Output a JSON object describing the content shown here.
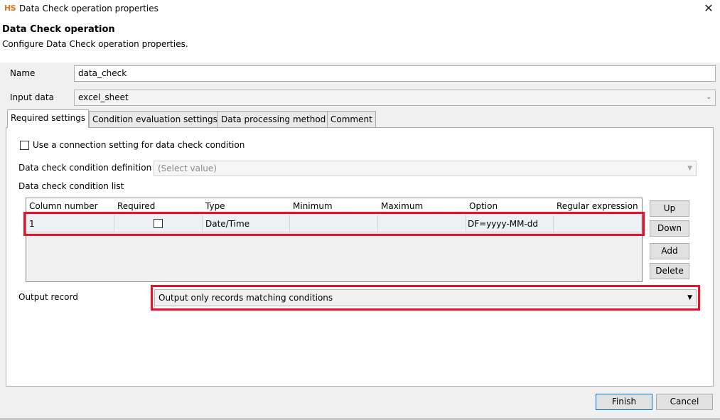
{
  "window": {
    "logo": "HS",
    "title": "Data Check operation properties",
    "close_glyph": "✕"
  },
  "header": {
    "title": "Data Check operation",
    "description": "Configure Data Check operation properties."
  },
  "fields": {
    "name_label": "Name",
    "name_value": "data_check",
    "input_label": "Input data",
    "input_value": "excel_sheet"
  },
  "tabs": [
    {
      "label": "Required settings",
      "active": true
    },
    {
      "label": "Condition evaluation settings",
      "active": false
    },
    {
      "label": "Data processing method",
      "active": false
    },
    {
      "label": "Comment",
      "active": false
    }
  ],
  "required": {
    "use_connection_label": "Use a connection setting for data check condition",
    "use_connection_checked": false,
    "definition_label": "Data check condition definition",
    "definition_placeholder": "(Select value)",
    "list_label": "Data check condition list",
    "columns": [
      "Column number",
      "Required",
      "Type",
      "Minimum",
      "Maximum",
      "Option",
      "Regular expression"
    ],
    "rows": [
      {
        "column_number": "1",
        "required": false,
        "type": "Date/Time",
        "minimum": "",
        "maximum": "",
        "option": "DF=yyyy-MM-dd",
        "regex": ""
      }
    ],
    "buttons": {
      "up": "Up",
      "down": "Down",
      "add": "Add",
      "delete": "Delete"
    },
    "output_label": "Output record",
    "output_value": "Output only records matching conditions"
  },
  "footer": {
    "finish": "Finish",
    "cancel": "Cancel"
  },
  "colors": {
    "highlight": "#e8132a",
    "primary_border": "#0078d7"
  }
}
